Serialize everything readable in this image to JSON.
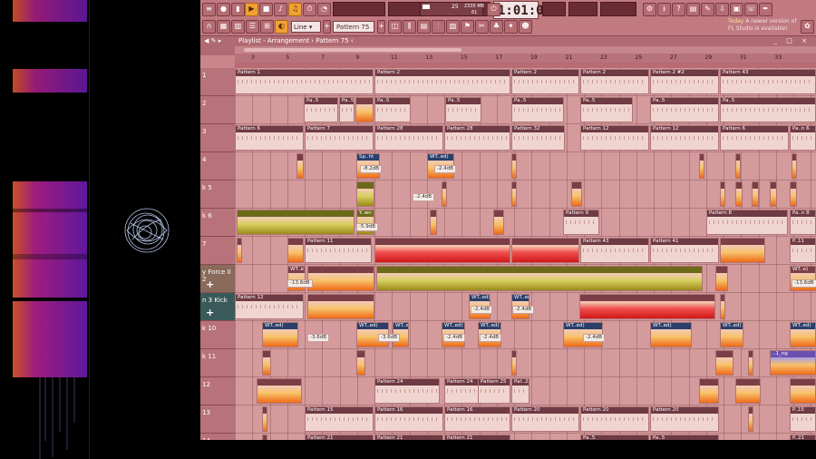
{
  "toolbar": {
    "time": "1:01:00",
    "time_unit": "B:S:T",
    "pattern_selector": "Pattern 75",
    "snap_selector": "Line",
    "cpu_value": "25",
    "memory": "2335 MB",
    "poly": "61",
    "news_prefix": "Today",
    "news_text": "A newer version of FL Studio is available!"
  },
  "playlist": {
    "title": "Playlist - Arrangement › Pattern 75 ‹",
    "controls": "_ □ ×",
    "ruler": [
      "3",
      "5",
      "7",
      "9",
      "11",
      "13",
      "15",
      "17",
      "19",
      "21",
      "23",
      "25",
      "27",
      "29",
      "31",
      "33"
    ]
  },
  "tracks": [
    {
      "label": "1"
    },
    {
      "label": "2"
    },
    {
      "label": "3"
    },
    {
      "label": "4"
    },
    {
      "label": "k 5"
    },
    {
      "label": "k 6"
    },
    {
      "label": "7"
    },
    {
      "label": "y Force II 2"
    },
    {
      "label": "n 3 Kick"
    },
    {
      "label": "k 10"
    },
    {
      "label": "k 11"
    },
    {
      "label": "12"
    },
    {
      "label": "13"
    },
    {
      "label": "14"
    }
  ],
  "clips": {
    "pattern1": "Pattern 1",
    "pattern2": "Pattern 2",
    "pattern2b": "Pattern 2",
    "pattern2c": "Pattern 2",
    "pattern2d": "Pattern 2 #2",
    "pattern43": "Pattern 43",
    "pa5": "Pa..5",
    "pattern6": "Pattern 6",
    "pattern7": "Pattern 7",
    "pattern28a": "Pattern 28",
    "pattern28b": "Pattern 28",
    "pattern32": "Pattern 32",
    "pattern12a": "Pattern 12",
    "pattern12b": "Pattern 12",
    "pattern6b": "Pattern 6",
    "pae6": "Pa..n 6",
    "pattern9": "Pattern 9",
    "pattern8": "Pattern 8",
    "pan8": "Pa..n 8",
    "pattern11": "Pattern 11",
    "pattern43b": "Pattern 43",
    "pattern41": "Pattern 41",
    "p11": "P..11",
    "pattern12c": "Pattern 12",
    "pattern24a": "Pattern 24",
    "pattern24b": "Pattern 24",
    "pattern25": "Pattern 25",
    "pat24": "Pat..24",
    "pattern15": "Pattern 15",
    "pattern16a": "Pattern 16",
    "pattern16b": "Pattern 16",
    "pattern20a": "Pattern 20",
    "pattern20b": "Pattern 20",
    "pattern20c": "Pattern 20",
    "p15": "P..15",
    "pattern21a": "Pattern 21",
    "pattern21b": "Pattern 21",
    "pattern21c": "Pattern 21",
    "p21": "P..21",
    "sp": "Sp..ht",
    "wted": "WT..ed)",
    "ywn": "Y..wn",
    "wte": "WT..e)",
    "ng": "..1_ng",
    "db1": "-8.2dB",
    "db2": "-2.4dB",
    "db3": "-2.4dB",
    "db4": "-5.9dB",
    "db5": "-13.6dB",
    "db6": "-2.4dB",
    "db7": "-2.4dB",
    "db8": "-3.6dB",
    "db9": "-3.6dB",
    "db10": "-2.4dB",
    "db11": "-2.4dB",
    "db12": "-2.4dB",
    "db13": "-13.6dB"
  },
  "colors": {
    "accent": "#f1a133",
    "playlist_bg": "#d49a9c",
    "clip_header": "#7b3e47"
  }
}
